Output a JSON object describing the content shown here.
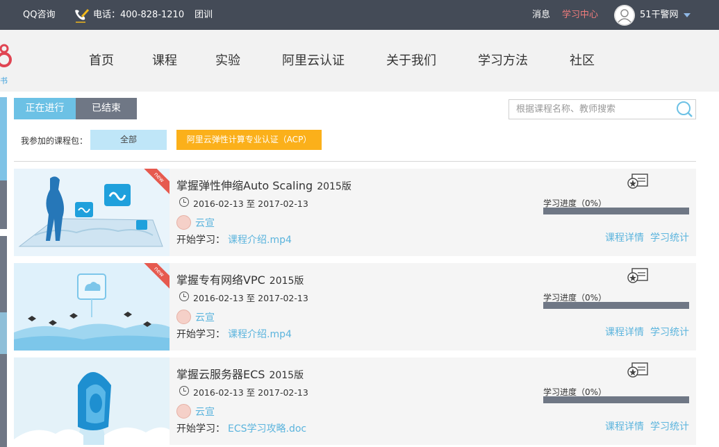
{
  "topbar": {
    "qq": "QQ咨询",
    "phone": "电话：400-828-1210",
    "group": "团训",
    "messages": "消息",
    "learning_center": "学习中心",
    "username": "51干警网"
  },
  "logo": {
    "sub": "书"
  },
  "nav": [
    "首页",
    "课程",
    "实验",
    "阿里云认证",
    "关于我们",
    "学习方法",
    "社区"
  ],
  "tabs": {
    "active": "正在进行",
    "ended": "已结束"
  },
  "search": {
    "placeholder": "根据课程名称、教师搜索"
  },
  "filter": {
    "label": "我参加的课程包：",
    "all": "全部",
    "acp": "阿里云弹性计算专业认证（ACP）"
  },
  "courses": [
    {
      "title": "掌握弹性伸缩Auto Scaling",
      "version": "2015版",
      "date_start": "2016-02-13",
      "date_sep": "至",
      "date_end": "2017-02-13",
      "teacher": "云宣",
      "start_label": "开始学习：",
      "start_file": "课程介绍.mp4",
      "progress_label": "学习进度（0%）",
      "progress": 0,
      "detail": "课程详情",
      "stats": "学习统计",
      "new_badge": "new"
    },
    {
      "title": "掌握专有网络VPC",
      "version": "2015版",
      "date_start": "2016-02-13",
      "date_sep": "至",
      "date_end": "2017-02-13",
      "teacher": "云宣",
      "start_label": "开始学习：",
      "start_file": "课程介绍.mp4",
      "progress_label": "学习进度（0%）",
      "progress": 0,
      "detail": "课程详情",
      "stats": "学习统计",
      "new_badge": "new"
    },
    {
      "title": "掌握云服务器ECS",
      "version": "2015版",
      "date_start": "2016-02-13",
      "date_sep": "至",
      "date_end": "2017-02-13",
      "teacher": "云宣",
      "start_label": "开始学习：",
      "start_file": "ECS学习攻略.doc",
      "progress_label": "学习进度（0%）",
      "progress": 0,
      "detail": "课程详情",
      "stats": "学习统计"
    }
  ],
  "colors": {
    "topbar": "#444b57",
    "accent_blue": "#6cc1e5",
    "link_blue": "#5bb4dd",
    "acp_orange": "#fbb01a",
    "learn_center": "#f07c7c",
    "tab_gray": "#6f7785"
  },
  "icons": {
    "phone": "phone-pen-icon",
    "avatar": "user-avatar-icon",
    "dropdown": "caret-down-icon",
    "search": "search-icon",
    "clock": "clock-icon",
    "certificate": "certificate-icon"
  }
}
